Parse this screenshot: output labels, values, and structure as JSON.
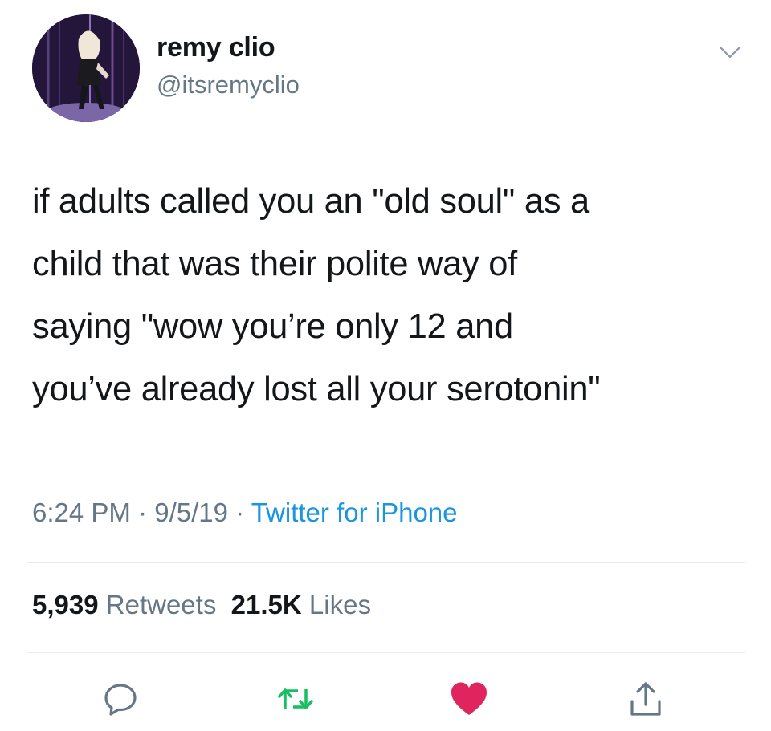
{
  "author": {
    "name": "remy clio",
    "handle": "@itsremyclio",
    "avatar_icon": "profile-photo"
  },
  "tweet": {
    "lines": [
      "if adults called you an \"old soul\" as a",
      "child that was their polite way of",
      "saying \"wow you’re only 12 and",
      "you’ve already lost all your serotonin\""
    ]
  },
  "meta": {
    "time": "6:24 PM",
    "separator": " · ",
    "date": "9/5/19",
    "separator2": " · ",
    "source": "Twitter for iPhone"
  },
  "stats": {
    "retweets_count": "5,939",
    "retweets_label": "Retweets",
    "likes_count": "21.5K",
    "likes_label": "Likes"
  },
  "actions": {
    "reply_icon": "reply-icon",
    "retweet_icon": "retweet-icon",
    "like_icon": "heart-icon",
    "share_icon": "share-icon"
  },
  "colors": {
    "text": "#14171a",
    "secondary": "#657786",
    "link": "#1b95e0",
    "retweet": "#17bf63",
    "like": "#e0245e",
    "divider": "#e6ecf0"
  }
}
